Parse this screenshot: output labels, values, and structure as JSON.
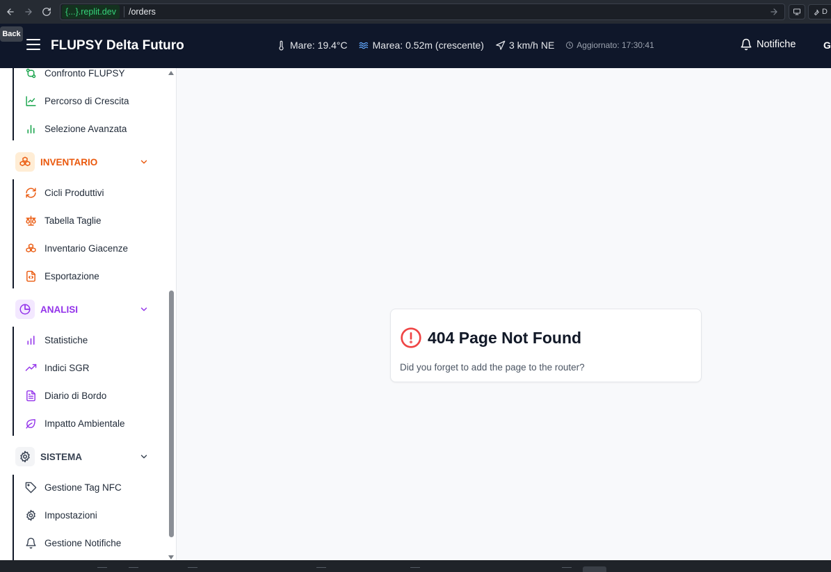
{
  "browser": {
    "domain": "{...}.replit.dev",
    "path": "/orders",
    "back_tooltip": "Back",
    "right_button_label": "D"
  },
  "header": {
    "title": "FLUPSY Delta Futuro",
    "weather": {
      "sea_temp": "Mare: 19.4°C",
      "tide": "Marea: 0.52m (crescente)",
      "wind": "3 km/h NE",
      "updated": "Aggiornato: 17:30:41"
    },
    "notifications_label": "Notifiche",
    "user_initial": "G"
  },
  "sidebar": {
    "top_items": [
      {
        "label": "Confronto FLUPSY",
        "icon": "git-compare-icon"
      },
      {
        "label": "Percorso di Crescita",
        "icon": "line-chart-icon"
      },
      {
        "label": "Selezione Avanzata",
        "icon": "bar-chart-icon"
      }
    ],
    "sections": [
      {
        "title": "INVENTARIO",
        "icon": "boxes-icon",
        "color": "#ea580c",
        "items": [
          {
            "label": "Cicli Produttivi",
            "icon": "refresh-icon"
          },
          {
            "label": "Tabella Taglie",
            "icon": "scale-icon"
          },
          {
            "label": "Inventario Giacenze",
            "icon": "boxes-icon"
          },
          {
            "label": "Esportazione",
            "icon": "file-code-icon"
          }
        ]
      },
      {
        "title": "ANALISI",
        "icon": "pie-chart-icon",
        "color": "#9333ea",
        "items": [
          {
            "label": "Statistiche",
            "icon": "bar-chart-icon"
          },
          {
            "label": "Indici SGR",
            "icon": "trending-up-icon"
          },
          {
            "label": "Diario di Bordo",
            "icon": "file-text-icon"
          },
          {
            "label": "Impatto Ambientale",
            "icon": "leaf-icon"
          }
        ]
      },
      {
        "title": "SISTEMA",
        "icon": "gear-icon",
        "color": "#374151",
        "items": [
          {
            "label": "Gestione Tag NFC",
            "icon": "tag-icon"
          },
          {
            "label": "Impostazioni",
            "icon": "gear-icon"
          },
          {
            "label": "Gestione Notifiche",
            "icon": "bell-icon"
          }
        ]
      }
    ]
  },
  "error": {
    "title": "404 Page Not Found",
    "message": "Did you forget to add the page to the router?",
    "accent": "#ef4444"
  }
}
